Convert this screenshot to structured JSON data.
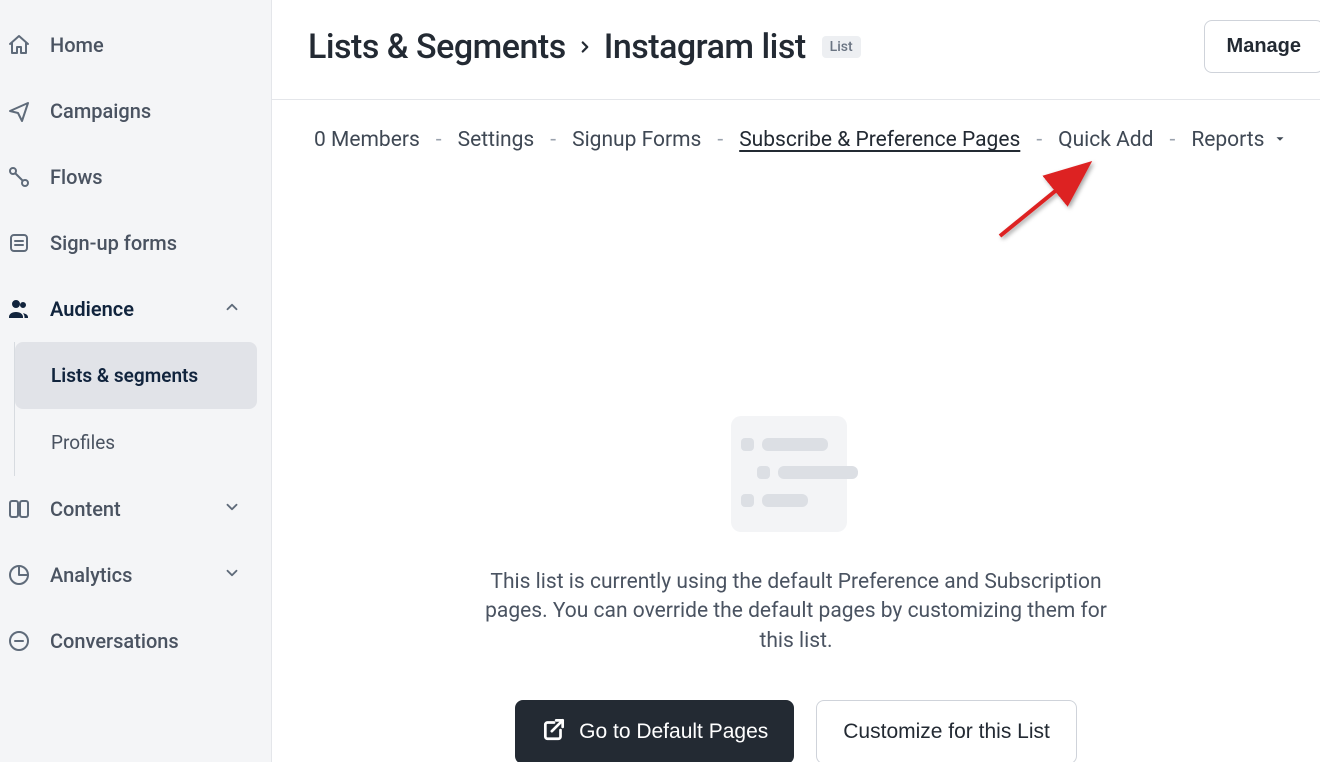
{
  "sidebar": {
    "items": [
      {
        "label": "Home"
      },
      {
        "label": "Campaigns"
      },
      {
        "label": "Flows"
      },
      {
        "label": "Sign-up forms"
      },
      {
        "label": "Audience"
      },
      {
        "label": "Content"
      },
      {
        "label": "Analytics"
      },
      {
        "label": "Conversations"
      }
    ],
    "audience_sub": [
      {
        "label": "Lists & segments"
      },
      {
        "label": "Profiles"
      }
    ]
  },
  "breadcrumb": {
    "root": "Lists & Segments",
    "current": "Instagram list",
    "badge": "List"
  },
  "manage_label": "Manage",
  "subnav": {
    "members": "0 Members",
    "settings": "Settings",
    "signup": "Signup Forms",
    "subpref": "Subscribe & Preference Pages",
    "quickadd": "Quick Add",
    "reports": "Reports"
  },
  "empty": {
    "desc": "This list is currently using the default Preference and Subscription pages. You can override the default pages by customizing them for this list.",
    "goto": "Go to Default Pages",
    "customize": "Customize for this List"
  }
}
